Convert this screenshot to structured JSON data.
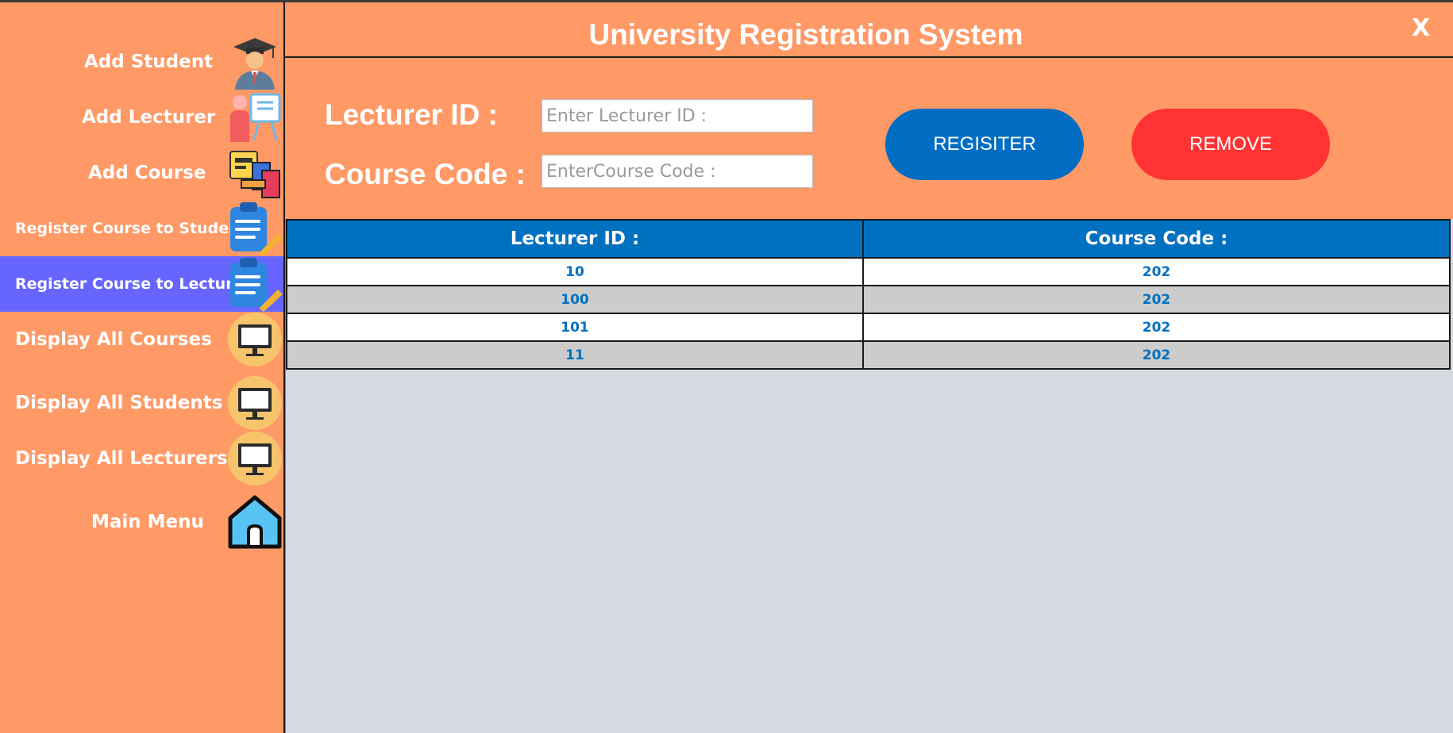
{
  "app": {
    "title": "University Registration System",
    "close_label": "X"
  },
  "sidebar": {
    "items": [
      {
        "label": "Add Student",
        "icon": "graduate-icon"
      },
      {
        "label": "Add Lecturer",
        "icon": "lecturer-icon"
      },
      {
        "label": "Add Course",
        "icon": "course-books-icon"
      },
      {
        "label": "Register Course to Student",
        "icon": "clipboard-icon"
      },
      {
        "label": "Register Course to Lecturer",
        "icon": "clipboard-icon",
        "active": true
      },
      {
        "label": "Display All Courses",
        "icon": "monitor-icon"
      },
      {
        "label": "Display All Students",
        "icon": "monitor-icon"
      },
      {
        "label": "Display All Lecturers",
        "icon": "monitor-icon"
      },
      {
        "label": "Main Menu",
        "icon": "home-icon"
      }
    ]
  },
  "form": {
    "lecturer_id_label": "Lecturer ID :",
    "lecturer_id_placeholder": "Enter Lecturer ID :",
    "lecturer_id_value": "",
    "course_code_label": "Course Code :",
    "course_code_placeholder": "EnterCourse Code :",
    "course_code_value": "",
    "register_label": "REGISITER",
    "remove_label": "REMOVE"
  },
  "table": {
    "columns": [
      "Lecturer ID :",
      "Course Code :"
    ],
    "rows": [
      [
        "10",
        "202"
      ],
      [
        "100",
        "202"
      ],
      [
        "101",
        "202"
      ],
      [
        "11",
        "202"
      ]
    ]
  },
  "colors": {
    "background": "#FF9966",
    "active_item": "#6666FF",
    "header": "#0070C0",
    "register": "#006DC2",
    "remove": "#FF3333"
  }
}
